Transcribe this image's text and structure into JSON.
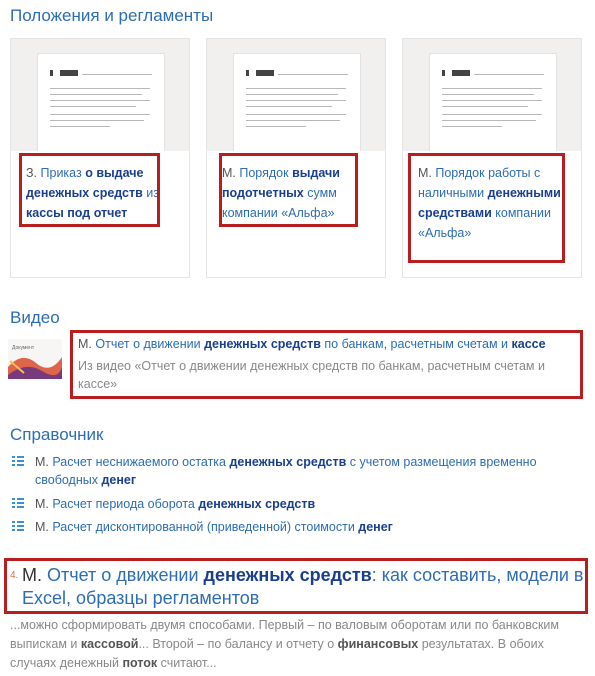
{
  "sections": {
    "regulations_title": "Положения и регламенты",
    "video_title": "Видео",
    "reference_title": "Справочник"
  },
  "cards": [
    {
      "prefix": "З.",
      "t1": "Приказ",
      "b1": "о выдаче денежных средств",
      "t2": "из",
      "b2": "кассы под отчет"
    },
    {
      "prefix": "М.",
      "t1": "Порядок",
      "b1": "выдачи подотчетных",
      "t2": "сумм компании «Альфа»"
    },
    {
      "prefix": "М.",
      "t1": "Порядок работы с наличными",
      "b1": "денежными средствами",
      "t2": "компании «Альфа»"
    }
  ],
  "video": {
    "icon_label": "Документ",
    "prefix": "М.",
    "t1": "Отчет о движении",
    "b1": "денежных средств",
    "t2": "по банкам, расчетным счетам и",
    "b2": "кассе",
    "desc": "Из видео «Отчет о движении денежных средств по банкам, расчетным счетам и кассе»"
  },
  "reference_items": [
    {
      "prefix": "М.",
      "t1": "Расчет неснижаемого остатка",
      "b1": "денежных средств",
      "t2": "с учетом размещения временно свободных",
      "b2": "денег"
    },
    {
      "prefix": "М.",
      "t1": "Расчет периода оборота",
      "b1": "денежных средств"
    },
    {
      "prefix": "М.",
      "t1": "Расчет дисконтированной (приведенной) стоимости",
      "b1": "денег"
    }
  ],
  "article": {
    "number": "4.",
    "prefix": "М.",
    "t1": "Отчет о движении",
    "b1": "денежных средств",
    "t2": ": как составить, модели в Excel, образцы регламентов",
    "s1": "...можно сформировать двумя способами. Первый – по валовым оборотам или по банковским выпискам и",
    "h1": "кассовой",
    "s2": "... Второй – по балансу и отчету о",
    "h2": "финансовых",
    "s3": "результатах. В обоих случаях денежный",
    "h3": "поток",
    "s4": "считают..."
  },
  "colors": {
    "link": "#2c6db5",
    "bold_link": "#1a3f8f",
    "highlight_box": "#b81e1e",
    "list_icon": "#3a8fd8"
  }
}
